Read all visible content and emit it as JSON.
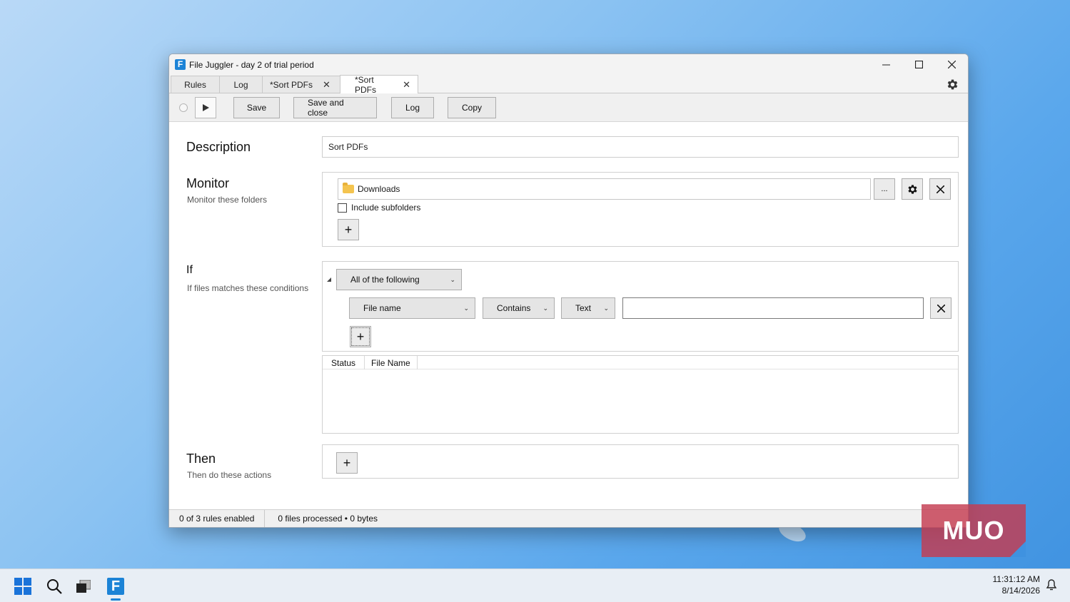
{
  "window": {
    "title": "File Juggler - day 2 of trial period",
    "app_logo_letter": "F"
  },
  "tabs": [
    {
      "label": "Rules",
      "closable": false
    },
    {
      "label": "Log",
      "closable": false
    },
    {
      "label": "*Sort PDFs",
      "closable": true
    },
    {
      "label": "*Sort PDFs",
      "closable": true,
      "active": true
    }
  ],
  "toolbar": {
    "save_label": "Save",
    "save_close_label": "Save and close",
    "log_label": "Log",
    "copy_label": "Copy"
  },
  "description": {
    "title": "Description",
    "value": "Sort PDFs"
  },
  "monitor": {
    "title": "Monitor",
    "subtitle": "Monitor these folders",
    "folder": "Downloads",
    "browse_label": "...",
    "include_subfolders_label": "Include subfolders",
    "include_subfolders_checked": false,
    "add_label": "+"
  },
  "if": {
    "title": "If",
    "subtitle": "If files matches these conditions",
    "match_mode": "All of the following",
    "condition": {
      "field": "File name",
      "operator": "Contains",
      "type": "Text",
      "value": ""
    },
    "add_label": "+",
    "grid_columns": [
      "Status",
      "File Name"
    ]
  },
  "then": {
    "title": "Then",
    "subtitle": "Then do these actions",
    "add_label": "+"
  },
  "statusbar": {
    "rules": "0 of 3 rules enabled",
    "files": "0 files processed • 0 bytes"
  },
  "watermark": "MUO",
  "taskbar": {
    "time": "11:31:12 AM",
    "date": "8/14/2026"
  },
  "colors": {
    "accent": "#1c83d6",
    "watermark": "#c43c50"
  }
}
